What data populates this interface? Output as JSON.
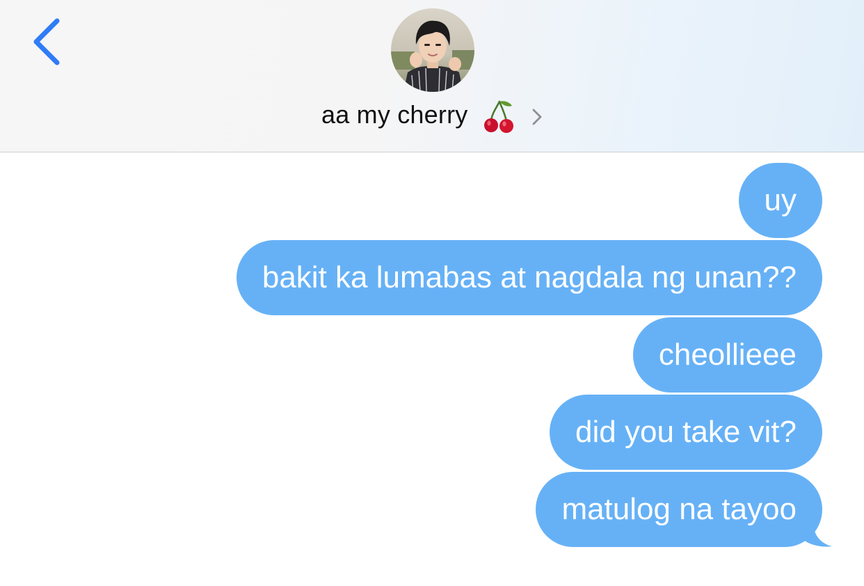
{
  "header": {
    "contact_name": "aa my cherry",
    "contact_emoji": "🍒",
    "back_icon": "chevron-left-icon",
    "details_icon": "chevron-right-icon",
    "avatar": "contact-avatar-photo"
  },
  "messages": [
    {
      "direction": "outgoing",
      "text": "uy"
    },
    {
      "direction": "outgoing",
      "text": "bakit ka lumabas at nagdala ng unan??"
    },
    {
      "direction": "outgoing",
      "text": "cheollieee"
    },
    {
      "direction": "outgoing",
      "text": "did you take vit?"
    },
    {
      "direction": "outgoing",
      "text": "matulog na tayoo"
    }
  ],
  "colors": {
    "accent": "#2f7cf6",
    "outgoing_bubble": "#66b1f6",
    "bubble_text": "#ffffff",
    "header_background": "#f6f6f7"
  }
}
